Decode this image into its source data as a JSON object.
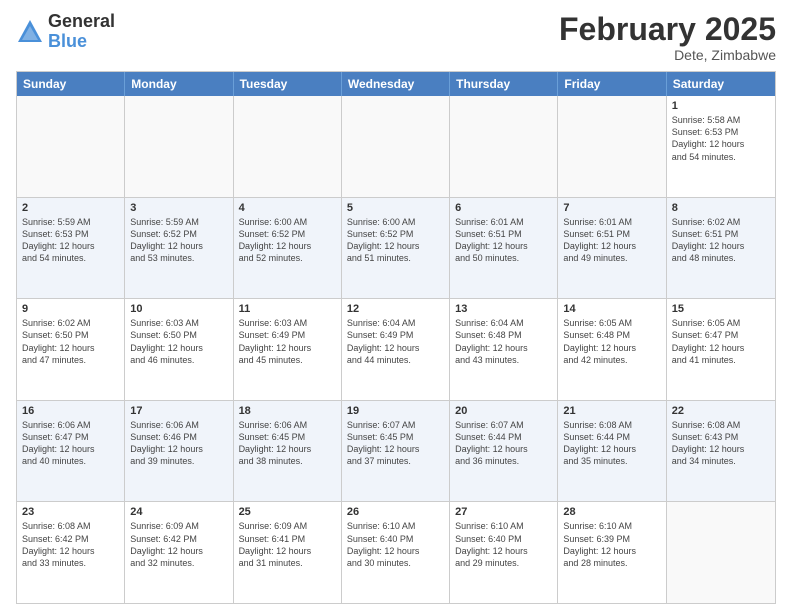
{
  "logo": {
    "general": "General",
    "blue": "Blue"
  },
  "title": {
    "month": "February 2025",
    "location": "Dete, Zimbabwe"
  },
  "header": {
    "days": [
      "Sunday",
      "Monday",
      "Tuesday",
      "Wednesday",
      "Thursday",
      "Friday",
      "Saturday"
    ]
  },
  "weeks": [
    [
      {
        "day": "",
        "info": ""
      },
      {
        "day": "",
        "info": ""
      },
      {
        "day": "",
        "info": ""
      },
      {
        "day": "",
        "info": ""
      },
      {
        "day": "",
        "info": ""
      },
      {
        "day": "",
        "info": ""
      },
      {
        "day": "1",
        "info": "Sunrise: 5:58 AM\nSunset: 6:53 PM\nDaylight: 12 hours\nand 54 minutes."
      }
    ],
    [
      {
        "day": "2",
        "info": "Sunrise: 5:59 AM\nSunset: 6:53 PM\nDaylight: 12 hours\nand 54 minutes."
      },
      {
        "day": "3",
        "info": "Sunrise: 5:59 AM\nSunset: 6:52 PM\nDaylight: 12 hours\nand 53 minutes."
      },
      {
        "day": "4",
        "info": "Sunrise: 6:00 AM\nSunset: 6:52 PM\nDaylight: 12 hours\nand 52 minutes."
      },
      {
        "day": "5",
        "info": "Sunrise: 6:00 AM\nSunset: 6:52 PM\nDaylight: 12 hours\nand 51 minutes."
      },
      {
        "day": "6",
        "info": "Sunrise: 6:01 AM\nSunset: 6:51 PM\nDaylight: 12 hours\nand 50 minutes."
      },
      {
        "day": "7",
        "info": "Sunrise: 6:01 AM\nSunset: 6:51 PM\nDaylight: 12 hours\nand 49 minutes."
      },
      {
        "day": "8",
        "info": "Sunrise: 6:02 AM\nSunset: 6:51 PM\nDaylight: 12 hours\nand 48 minutes."
      }
    ],
    [
      {
        "day": "9",
        "info": "Sunrise: 6:02 AM\nSunset: 6:50 PM\nDaylight: 12 hours\nand 47 minutes."
      },
      {
        "day": "10",
        "info": "Sunrise: 6:03 AM\nSunset: 6:50 PM\nDaylight: 12 hours\nand 46 minutes."
      },
      {
        "day": "11",
        "info": "Sunrise: 6:03 AM\nSunset: 6:49 PM\nDaylight: 12 hours\nand 45 minutes."
      },
      {
        "day": "12",
        "info": "Sunrise: 6:04 AM\nSunset: 6:49 PM\nDaylight: 12 hours\nand 44 minutes."
      },
      {
        "day": "13",
        "info": "Sunrise: 6:04 AM\nSunset: 6:48 PM\nDaylight: 12 hours\nand 43 minutes."
      },
      {
        "day": "14",
        "info": "Sunrise: 6:05 AM\nSunset: 6:48 PM\nDaylight: 12 hours\nand 42 minutes."
      },
      {
        "day": "15",
        "info": "Sunrise: 6:05 AM\nSunset: 6:47 PM\nDaylight: 12 hours\nand 41 minutes."
      }
    ],
    [
      {
        "day": "16",
        "info": "Sunrise: 6:06 AM\nSunset: 6:47 PM\nDaylight: 12 hours\nand 40 minutes."
      },
      {
        "day": "17",
        "info": "Sunrise: 6:06 AM\nSunset: 6:46 PM\nDaylight: 12 hours\nand 39 minutes."
      },
      {
        "day": "18",
        "info": "Sunrise: 6:06 AM\nSunset: 6:45 PM\nDaylight: 12 hours\nand 38 minutes."
      },
      {
        "day": "19",
        "info": "Sunrise: 6:07 AM\nSunset: 6:45 PM\nDaylight: 12 hours\nand 37 minutes."
      },
      {
        "day": "20",
        "info": "Sunrise: 6:07 AM\nSunset: 6:44 PM\nDaylight: 12 hours\nand 36 minutes."
      },
      {
        "day": "21",
        "info": "Sunrise: 6:08 AM\nSunset: 6:44 PM\nDaylight: 12 hours\nand 35 minutes."
      },
      {
        "day": "22",
        "info": "Sunrise: 6:08 AM\nSunset: 6:43 PM\nDaylight: 12 hours\nand 34 minutes."
      }
    ],
    [
      {
        "day": "23",
        "info": "Sunrise: 6:08 AM\nSunset: 6:42 PM\nDaylight: 12 hours\nand 33 minutes."
      },
      {
        "day": "24",
        "info": "Sunrise: 6:09 AM\nSunset: 6:42 PM\nDaylight: 12 hours\nand 32 minutes."
      },
      {
        "day": "25",
        "info": "Sunrise: 6:09 AM\nSunset: 6:41 PM\nDaylight: 12 hours\nand 31 minutes."
      },
      {
        "day": "26",
        "info": "Sunrise: 6:10 AM\nSunset: 6:40 PM\nDaylight: 12 hours\nand 30 minutes."
      },
      {
        "day": "27",
        "info": "Sunrise: 6:10 AM\nSunset: 6:40 PM\nDaylight: 12 hours\nand 29 minutes."
      },
      {
        "day": "28",
        "info": "Sunrise: 6:10 AM\nSunset: 6:39 PM\nDaylight: 12 hours\nand 28 minutes."
      },
      {
        "day": "",
        "info": ""
      }
    ]
  ]
}
